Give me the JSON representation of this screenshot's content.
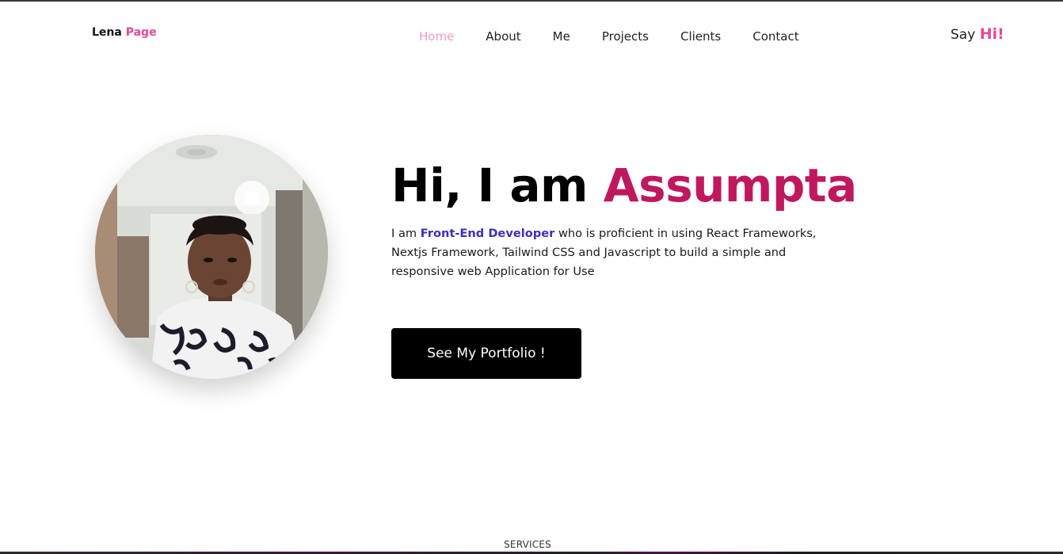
{
  "header": {
    "logo_first": "Lena",
    "logo_second": "Page",
    "nav": [
      {
        "label": "Home"
      },
      {
        "label": "About"
      },
      {
        "label": "Me"
      },
      {
        "label": "Projects"
      },
      {
        "label": "Clients"
      },
      {
        "label": "Contact"
      }
    ],
    "active_nav": "Home",
    "say_prefix": "Say",
    "say_hi": "Hi!"
  },
  "hero": {
    "greeting": "Hi, I am",
    "name": "Assumpta",
    "bio_prefix": "I am",
    "role": "Front-End Developer",
    "bio_suffix": "who is proficient in using React Frameworks, Nextjs Framework, Tailwind CSS and Javascript to build a simple and responsive web Application for Use",
    "cta_label": "See My Portfolio !"
  },
  "sections": {
    "services_label": "SERVICES"
  },
  "colors": {
    "accent_pink": "#e0489a",
    "name_magenta": "#c0185e",
    "role_blue": "#3b30b7",
    "active_nav": "#f19ac6",
    "cta_bg": "#000000"
  }
}
